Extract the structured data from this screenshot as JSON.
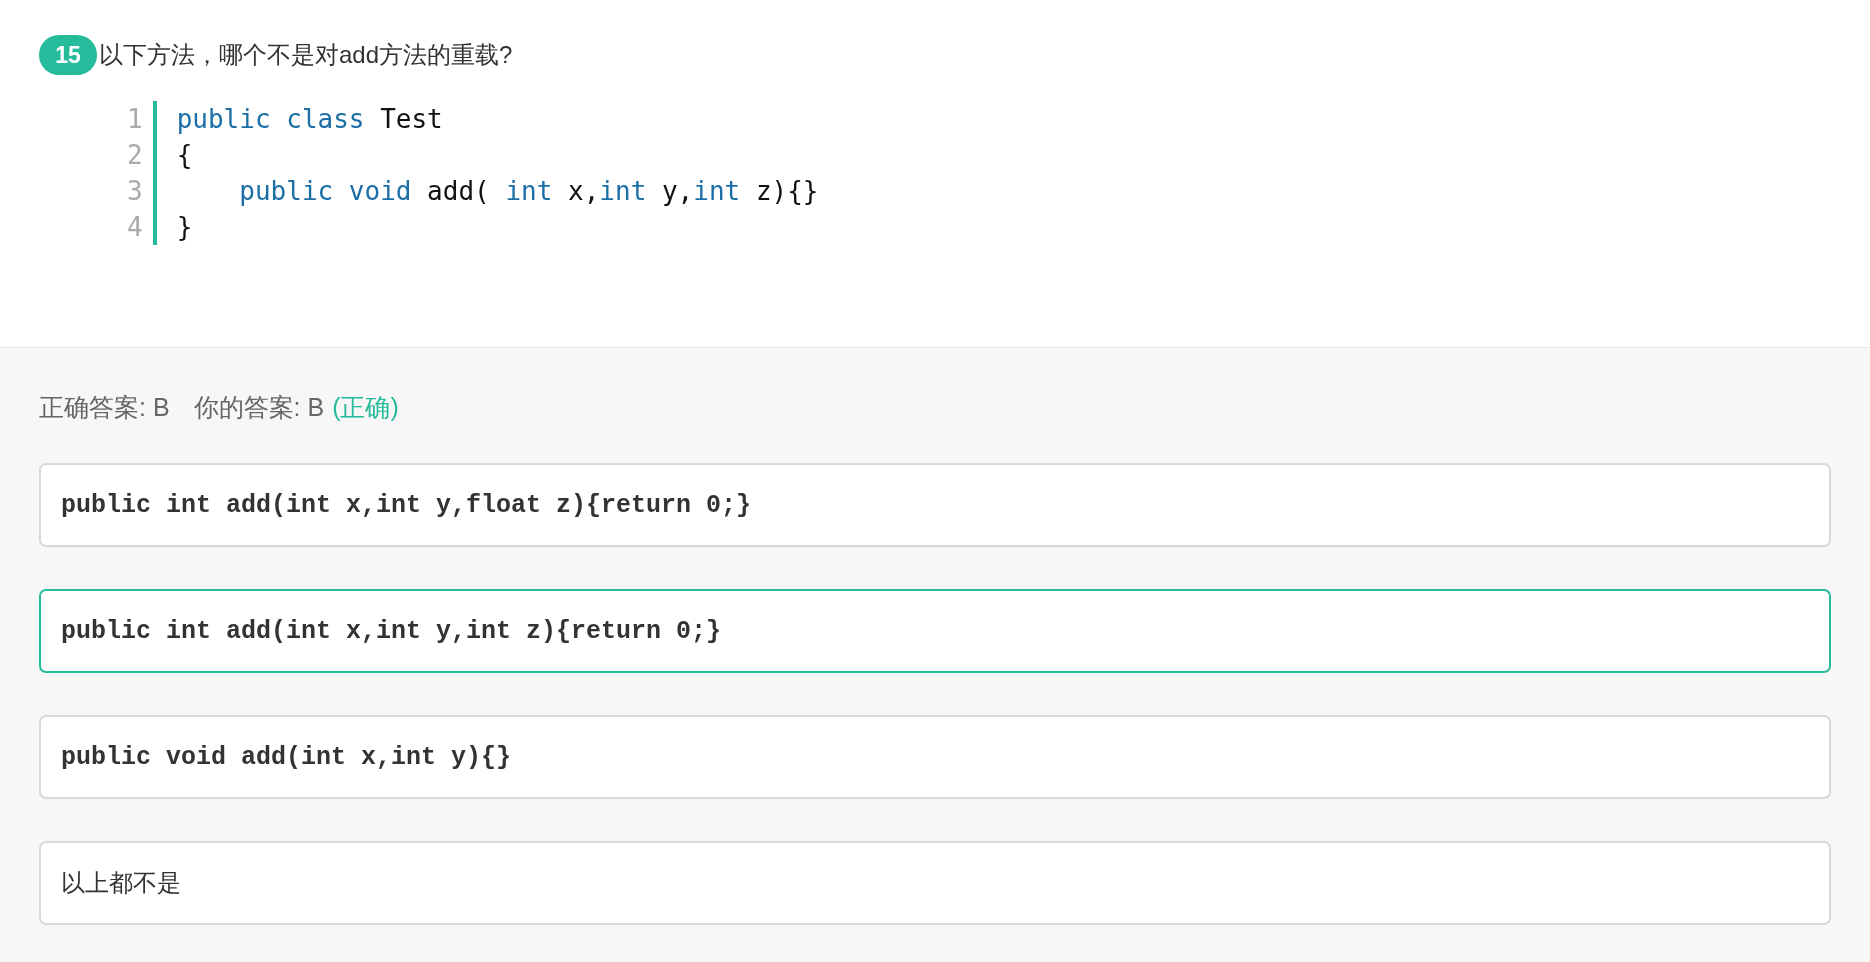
{
  "question": {
    "number": "15",
    "text": "以下方法，哪个不是对add方法的重载?"
  },
  "code": [
    {
      "number": "1",
      "tokens": [
        {
          "text": "public",
          "kind": "keyword"
        },
        {
          "text": " class",
          "kind": "keyword"
        },
        {
          "text": " Test",
          "kind": "plain"
        }
      ]
    },
    {
      "number": "2",
      "tokens": [
        {
          "text": "{",
          "kind": "plain"
        }
      ]
    },
    {
      "number": "3",
      "indented": true,
      "tokens": [
        {
          "text": "public",
          "kind": "keyword"
        },
        {
          "text": " void",
          "kind": "keyword"
        },
        {
          "text": " add( ",
          "kind": "plain"
        },
        {
          "text": "int",
          "kind": "keyword"
        },
        {
          "text": " x,",
          "kind": "plain"
        },
        {
          "text": "int",
          "kind": "keyword"
        },
        {
          "text": " y,",
          "kind": "plain"
        },
        {
          "text": "int",
          "kind": "keyword"
        },
        {
          "text": " z){}",
          "kind": "plain"
        }
      ]
    },
    {
      "number": "4",
      "tokens": [
        {
          "text": "}",
          "kind": "plain"
        }
      ]
    }
  ],
  "result": {
    "correct_answer": "正确答案: B",
    "your_answer": "你的答案: B",
    "verdict": "(正确)"
  },
  "options": [
    {
      "text": "public int add(int x,int y,float z){return 0;}",
      "kind": "code",
      "selected": false
    },
    {
      "text": "public int add(int x,int y,int z){return 0;}",
      "kind": "code",
      "selected": true
    },
    {
      "text": "public void add(int x,int y){}",
      "kind": "code",
      "selected": false
    },
    {
      "text": "以上都不是",
      "kind": "text",
      "selected": false
    }
  ]
}
